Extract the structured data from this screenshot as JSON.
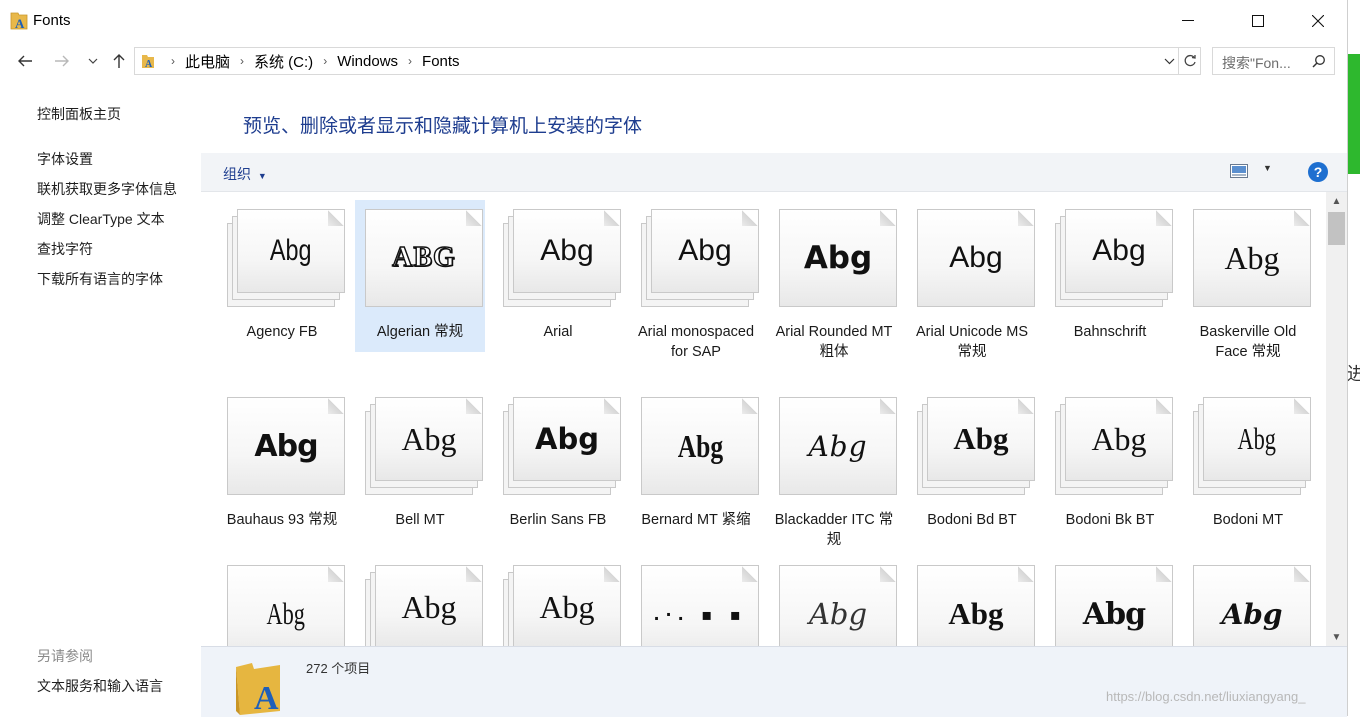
{
  "window": {
    "title": "Fonts",
    "minimize_glyph": "—",
    "maximize_glyph": "☐",
    "close_glyph": "✕"
  },
  "address": {
    "crumbs": [
      "此电脑",
      "系统 (C:)",
      "Windows",
      "Fonts"
    ],
    "search_placeholder": "搜索\"Fon..."
  },
  "sidebar": {
    "home": "控制面板主页",
    "links": [
      "字体设置",
      "联机获取更多字体信息",
      "调整 ClearType 文本",
      "查找字符",
      "下载所有语言的字体"
    ],
    "see_also_heading": "另请参阅",
    "see_also": [
      "文本服务和输入语言"
    ]
  },
  "main": {
    "heading": "预览、删除或者显示和隐藏计算机上安装的字体",
    "organize_label": "组织",
    "help_label": "?"
  },
  "fonts": [
    {
      "name": "Agency FB",
      "sample": "Abg",
      "style": "agency",
      "stacked": true
    },
    {
      "name": "Algerian 常规",
      "sample": "ABG",
      "style": "algerian",
      "stacked": false,
      "selected": true
    },
    {
      "name": "Arial",
      "sample": "Abg",
      "style": "arial",
      "stacked": true
    },
    {
      "name": "Arial monospaced for SAP",
      "sample": "Abg",
      "style": "arial",
      "stacked": true
    },
    {
      "name": "Arial Rounded MT 粗体",
      "sample": "Abg",
      "style": "rounded",
      "stacked": false
    },
    {
      "name": "Arial Unicode MS 常规",
      "sample": "Abg",
      "style": "arial",
      "stacked": false
    },
    {
      "name": "Bahnschrift",
      "sample": "Abg",
      "style": "arial",
      "stacked": true
    },
    {
      "name": "Baskerville Old Face 常规",
      "sample": "Abg",
      "style": "serif",
      "stacked": false
    },
    {
      "name": "Bauhaus 93 常规",
      "sample": "Abg",
      "style": "bauhaus",
      "stacked": false
    },
    {
      "name": "Bell MT",
      "sample": "Abg",
      "style": "serif",
      "stacked": true
    },
    {
      "name": "Berlin Sans FB",
      "sample": "Abg",
      "style": "berlin",
      "stacked": true
    },
    {
      "name": "Bernard MT 紧缩",
      "sample": "Abg",
      "style": "bernard",
      "stacked": false
    },
    {
      "name": "Blackadder ITC 常规",
      "sample": "Abg",
      "style": "script",
      "stacked": false
    },
    {
      "name": "Bodoni Bd BT",
      "sample": "Abg",
      "style": "bodonibold",
      "stacked": true
    },
    {
      "name": "Bodoni Bk BT",
      "sample": "Abg",
      "style": "serif",
      "stacked": true
    },
    {
      "name": "Bodoni MT",
      "sample": "Abg",
      "style": "condensed",
      "stacked": true
    },
    {
      "name": "",
      "sample": "Abg",
      "style": "condensed",
      "stacked": false
    },
    {
      "name": "",
      "sample": "Abg",
      "style": "serif",
      "stacked": true
    },
    {
      "name": "",
      "sample": "Abg",
      "style": "serif",
      "stacked": true
    },
    {
      "name": "",
      "sample": ".·. ▪ ▪",
      "style": "symbol",
      "stacked": false
    },
    {
      "name": "",
      "sample": "Abg",
      "style": "thinscript",
      "stacked": false
    },
    {
      "name": "",
      "sample": "Abg",
      "style": "bodonibold",
      "stacked": false
    },
    {
      "name": "",
      "sample": "Abg",
      "style": "black",
      "stacked": false
    },
    {
      "name": "",
      "sample": "Abg",
      "style": "italicbold",
      "stacked": false
    }
  ],
  "status": {
    "count": "272 个项目"
  },
  "watermark": "https://blog.csdn.net/liuxiangyang_",
  "edge_text": "进",
  "icons": [
    "back-arrow-icon",
    "forward-arrow-icon",
    "recent-dropdown-icon",
    "up-arrow-icon",
    "fonts-folder-icon",
    "search-icon",
    "refresh-icon",
    "view-icon",
    "help-icon"
  ]
}
